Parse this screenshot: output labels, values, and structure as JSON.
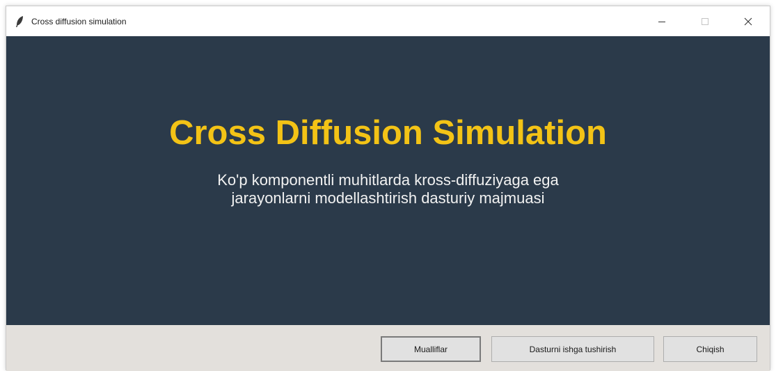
{
  "window": {
    "title": "Cross diffusion simulation",
    "app_icon": "feather-icon"
  },
  "caption_controls": {
    "minimize_icon": "minimize-icon",
    "maximize_icon": "maximize-icon",
    "close_icon": "close-icon"
  },
  "main": {
    "title": "Cross Diffusion Simulation",
    "subtitle_line1": "Ko'p komponentli muhitlarda kross-diffuziyaga ega",
    "subtitle_line2": "jarayonlarni modellashtirish dasturiy majmuasi"
  },
  "footer": {
    "authors_label": "Mualliflar",
    "run_label": "Dasturni ishga tushirish",
    "exit_label": "Chiqish"
  },
  "colors": {
    "content_background": "#2b3a4a",
    "title_color": "#f3c316",
    "subtitle_color": "#f2f2f2",
    "footer_background": "#e3e0dc"
  }
}
